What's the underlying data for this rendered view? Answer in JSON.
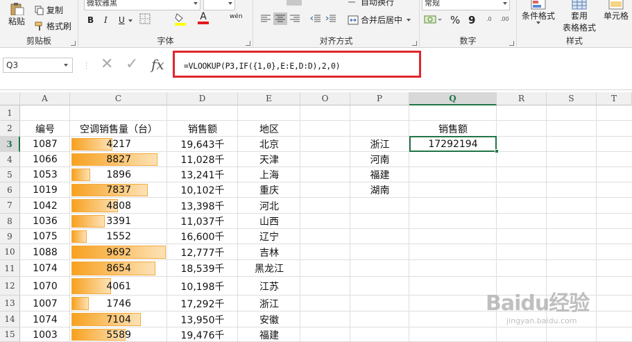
{
  "ribbon": {
    "clipboard": {
      "paste": "粘贴",
      "copy": "复制",
      "format_painter": "格式刷",
      "label": "剪贴板"
    },
    "font": {
      "name": "微软雅黑",
      "size": "",
      "label": "字体",
      "bold": "B",
      "italic": "I",
      "underline": "U",
      "phonetic": "wén"
    },
    "alignment": {
      "merge": "合并后居中",
      "wrap": "自动换行",
      "label": "对齐方式"
    },
    "number": {
      "format": "常规",
      "percent": "%",
      "comma": "9",
      "label": "数字"
    },
    "styles": {
      "conditional": "条件格式",
      "table_format_1": "套用",
      "table_format_2": "表格格式",
      "cell_styles": "单元格",
      "label": "样式"
    }
  },
  "formula_bar": {
    "name_box": "Q3",
    "fx": "fx",
    "formula": "=VLOOKUP(P3,IF({1,0},E:E,D:D),2,0)"
  },
  "columns": [
    "A",
    "C",
    "D",
    "E",
    "O",
    "P",
    "Q",
    "R",
    "S",
    "T"
  ],
  "row_numbers": [
    "1",
    "2",
    "3",
    "4",
    "5",
    "6",
    "7",
    "8",
    "9",
    "10",
    "11",
    "12",
    "13",
    "14",
    "15"
  ],
  "headers": {
    "id": "编号",
    "ac_sales": "空调销售量（台）",
    "sales": "销售额",
    "region": "地区",
    "q_header": "销售额"
  },
  "rows": [
    {
      "id": "1087",
      "qty": "4217",
      "qty_value": 4217,
      "sales": "19,643千",
      "region": "北京"
    },
    {
      "id": "1066",
      "qty": "8827",
      "qty_value": 8827,
      "sales": "11,028千",
      "region": "天津"
    },
    {
      "id": "1053",
      "qty": "1896",
      "qty_value": 1896,
      "sales": "13,241千",
      "region": "上海"
    },
    {
      "id": "1019",
      "qty": "7837",
      "qty_value": 7837,
      "sales": "10,102千",
      "region": "重庆"
    },
    {
      "id": "1042",
      "qty": "4808",
      "qty_value": 4808,
      "sales": "13,398千",
      "region": "河北"
    },
    {
      "id": "1036",
      "qty": "3391",
      "qty_value": 3391,
      "sales": "11,037千",
      "region": "山西"
    },
    {
      "id": "1075",
      "qty": "1552",
      "qty_value": 1552,
      "sales": "16,600千",
      "region": "辽宁"
    },
    {
      "id": "1088",
      "qty": "9692",
      "qty_value": 9692,
      "sales": "12,777千",
      "region": "吉林"
    },
    {
      "id": "1074",
      "qty": "8654",
      "qty_value": 8654,
      "sales": "18,539千",
      "region": "黑龙江"
    },
    {
      "id": "1070",
      "qty": "4061",
      "qty_value": 4061,
      "sales": "10,198千",
      "region": "江苏"
    },
    {
      "id": "1007",
      "qty": "1746",
      "qty_value": 1746,
      "sales": "17,292千",
      "region": "浙江"
    },
    {
      "id": "1074",
      "qty": "7104",
      "qty_value": 7104,
      "sales": "13,950千",
      "region": "安徽"
    },
    {
      "id": "1003",
      "qty": "5589",
      "qty_value": 5589,
      "sales": "19,476千",
      "region": "福建"
    }
  ],
  "lookup": {
    "provinces": [
      "浙江",
      "河南",
      "福建",
      "湖南"
    ],
    "result": "17292194"
  },
  "watermark": {
    "brand": "Baidu经验",
    "url": "jingyan.baidu.com"
  },
  "colors": {
    "accent": "#217346",
    "highlight": "#e0262c",
    "databar": "#f7a11f"
  }
}
